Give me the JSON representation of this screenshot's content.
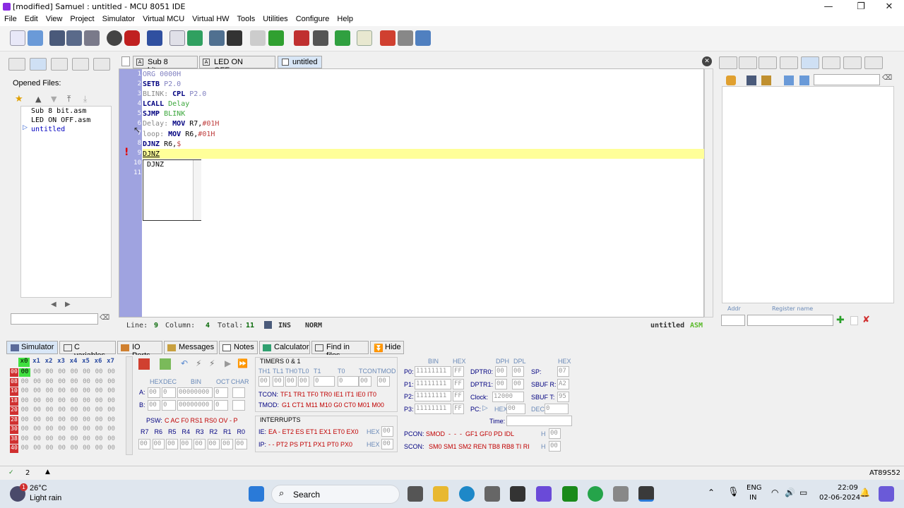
{
  "window": {
    "title": "[modified] Samuel : untitled - MCU 8051 IDE",
    "minimize": "—",
    "maximize": "❐",
    "close": "✕"
  },
  "menu": [
    "File",
    "Edit",
    "View",
    "Project",
    "Simulator",
    "Virtual MCU",
    "Virtual HW",
    "Tools",
    "Utilities",
    "Configure",
    "Help"
  ],
  "left": {
    "opened_files_label": "Opened Files:",
    "files": [
      "Sub 8 bit.asm",
      "LED ON OFF.asm",
      "untitled"
    ]
  },
  "editor": {
    "tabs": [
      "Sub 8 bit.asm",
      "LED ON OFF.asm",
      "untitled"
    ],
    "line_numbers": [
      "1",
      "2",
      "3",
      "4",
      "5",
      "6",
      "7",
      "8",
      "9",
      "10",
      "11"
    ],
    "autocomplete": "DJNZ"
  },
  "status": {
    "line_label": "Line:",
    "line": "9",
    "column_label": "Column:",
    "column": "4",
    "total_label": "Total:",
    "total": "11",
    "mode1": "INS",
    "mode2": "NORM",
    "file": "untitled",
    "type": "ASM"
  },
  "right": {
    "addr_label": "Addr",
    "regname_label": "Register name"
  },
  "bottom_tabs": [
    "Simulator",
    "C variables",
    "IO Ports",
    "Messages",
    "Notes",
    "Calculator",
    "Find in files",
    "Hide"
  ],
  "sim": {
    "reg_header": [
      "x0",
      "x1",
      "x2",
      "x3",
      "x4",
      "x5",
      "x6",
      "x7"
    ],
    "reg_rows": [
      "00",
      "08",
      "10",
      "18",
      "20",
      "28",
      "30",
      "38",
      "40"
    ],
    "reg_cell": "00",
    "hexdec": [
      "HEX",
      "DEC",
      "BIN",
      "OCT",
      "CHAR"
    ],
    "a_label": "A:",
    "b_label": "B:",
    "bin_val": "00000000",
    "zero": "00",
    "zero1": "0",
    "psw_label": "PSW:",
    "psw_bits": "C AC F0 RS1 RS0 OV - P",
    "rregs": [
      "R7",
      "R6",
      "R5",
      "R4",
      "R3",
      "R2",
      "R1",
      "R0"
    ],
    "timers_title": "TIMERS 0 & 1",
    "timers_cols": [
      "TH1",
      "TL1",
      "TH0",
      "TL0",
      "T1",
      "T0",
      "TCON",
      "TMOD"
    ],
    "tcon_label": "TCON:",
    "tcon_bits": "TF1 TR1 TF0 TR0 IE1 IT1 IE0 IT0",
    "tmod_label": "TMOD:",
    "tmod_bits": "G1 CT1 M11 M10 G0 CT0 M01 M00",
    "int_title": "INTERRUPTS",
    "ie_label": "IE:",
    "ie_bits": "EA - ET2 ES ET1 EX1 ET0 EX0",
    "ip_label": "IP:",
    "ip_bits": "- - PT2 PS PT1 PX1 PT0 PX0",
    "hex": "HEX",
    "bin": "BIN",
    "ports": [
      "P0:",
      "P1:",
      "P2:",
      "P3:"
    ],
    "port_bin": "11111111",
    "port_hex": "FF",
    "dptr": [
      "DPTR0:",
      "DPTR1:"
    ],
    "dph": "DPH",
    "dpl": "DPL",
    "clock_label": "Clock:",
    "clock": "12000",
    "pc_label": "PC:",
    "pc_hex": "00",
    "pc_dec": "0",
    "dec": "DEC",
    "time_label": "Time:",
    "sp_label": "SP:",
    "sp": "07",
    "sbufr_label": "SBUF R:",
    "sbufr": "A2",
    "sbuft_label": "SBUF T:",
    "sbuft": "95",
    "pcon_label": "PCON:",
    "pcon_bits": "SMOD  -  -  -  GF1 GF0 PD IDL",
    "scon_label": "SCON:",
    "scon_bits": "SM0 SM1 SM2 REN TB8 RB8 TI RI",
    "h": "H"
  },
  "bottom_status": {
    "count": "2",
    "chip": "AT89S52"
  },
  "taskbar": {
    "temp": "26°C",
    "weather": "Light rain",
    "search": "Search",
    "lang1": "ENG",
    "lang2": "IN",
    "time": "22:09",
    "date": "02-06-2024",
    "badge": "1"
  }
}
